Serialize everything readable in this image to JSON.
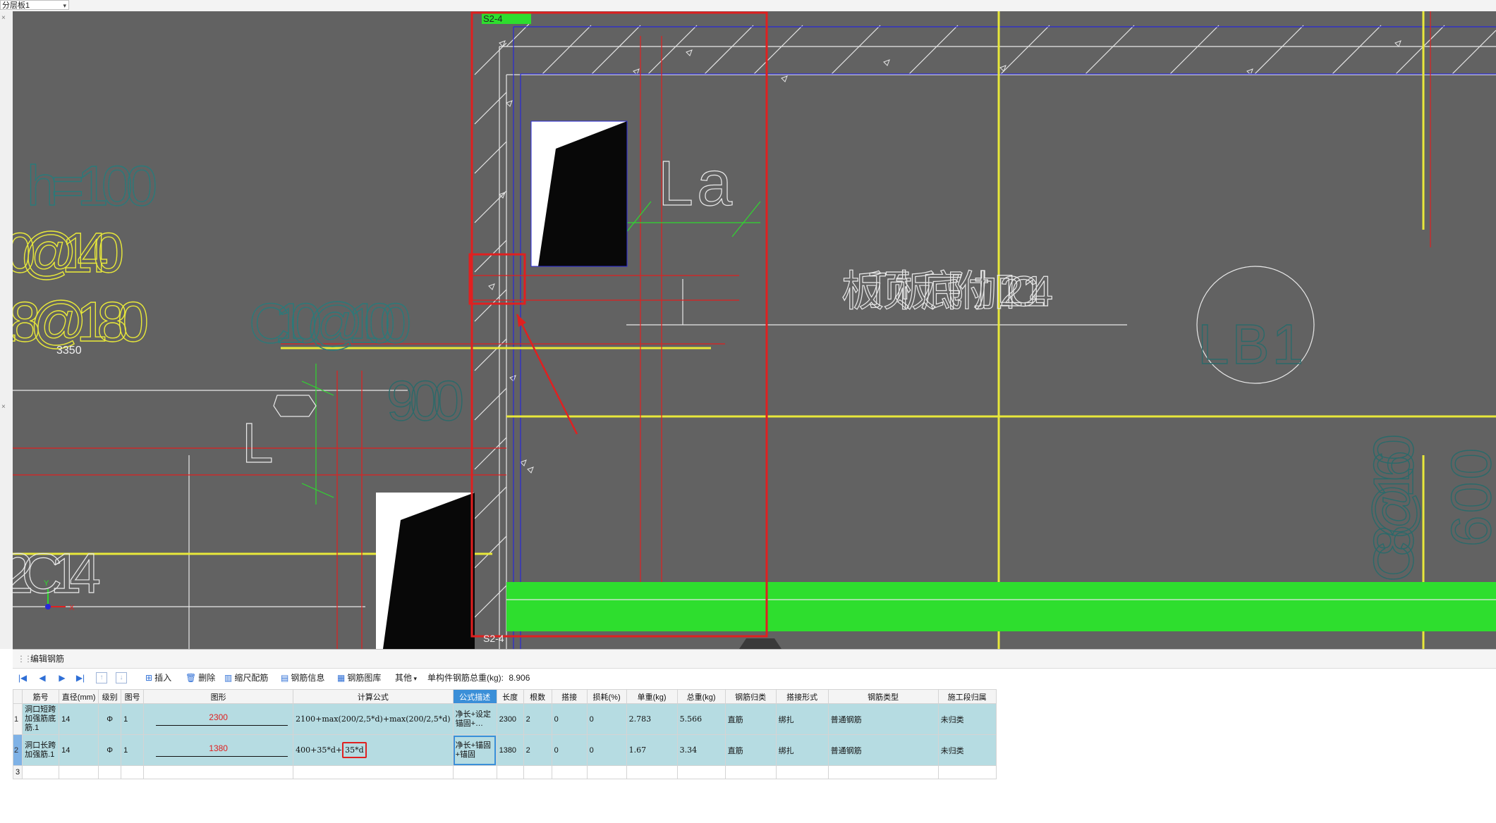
{
  "topbar": {
    "layer_selector": "分层板1"
  },
  "drawing": {
    "labels": {
      "section_top": "S2-4",
      "section_bottom": "S2-4",
      "la": "La",
      "add_rebar": "板顶板底附加2C14",
      "lb1": "LB1",
      "h100": "h=100",
      "s140": "0@140",
      "s180": ".8@180",
      "c10": "C10@100",
      "dim900": "900",
      "dim3350": "3350",
      "l_vert": "L",
      "c14": "2C14",
      "c8_160": "C8@160",
      "right_600": "600",
      "axis_x": "X",
      "axis_y": "Y"
    }
  },
  "panel": {
    "title": "编辑钢筋",
    "toolbar": {
      "insert": "插入",
      "delete": "删除",
      "scale_rebar": "缩尺配筋",
      "rebar_info": "钢筋信息",
      "rebar_library": "钢筋图库",
      "other": "其他",
      "total_label": "单构件钢筋总重(kg):",
      "total_value": "8.906"
    },
    "headers": [
      "筋号",
      "直径(mm)",
      "级别",
      "图号",
      "图形",
      "计算公式",
      "公式描述",
      "长度",
      "根数",
      "搭接",
      "损耗(%)",
      "单重(kg)",
      "总重(kg)",
      "钢筋归类",
      "搭接形式",
      "钢筋类型",
      "施工段归属"
    ],
    "rows": [
      {
        "index": "1",
        "name": "洞口短跨加强筋底筋.1",
        "diameter": "14",
        "grade": "Φ",
        "fig_no": "1",
        "shape_value": "2300",
        "formula": "2100+max(200/2,5*d)+max(200/2,5*d)",
        "desc": "净长+设定锚固+…",
        "length": "2300",
        "count": "2",
        "lap": "0",
        "loss": "0",
        "unit_weight": "2.783",
        "total_weight": "5.566",
        "category": "直筋",
        "lap_type": "绑扎",
        "rebar_type": "普通钢筋",
        "segment": "未归类"
      },
      {
        "index": "2",
        "name": "洞口长跨加强筋.1",
        "diameter": "14",
        "grade": "Φ",
        "fig_no": "1",
        "shape_value": "1380",
        "formula_a": "400+35*d+",
        "formula_b": "35*d",
        "desc": "净长+锚固+锚固",
        "length": "1380",
        "count": "2",
        "lap": "0",
        "loss": "0",
        "unit_weight": "1.67",
        "total_weight": "3.34",
        "category": "直筋",
        "lap_type": "绑扎",
        "rebar_type": "普通钢筋",
        "segment": "未归类"
      },
      {
        "index": "3"
      }
    ]
  }
}
